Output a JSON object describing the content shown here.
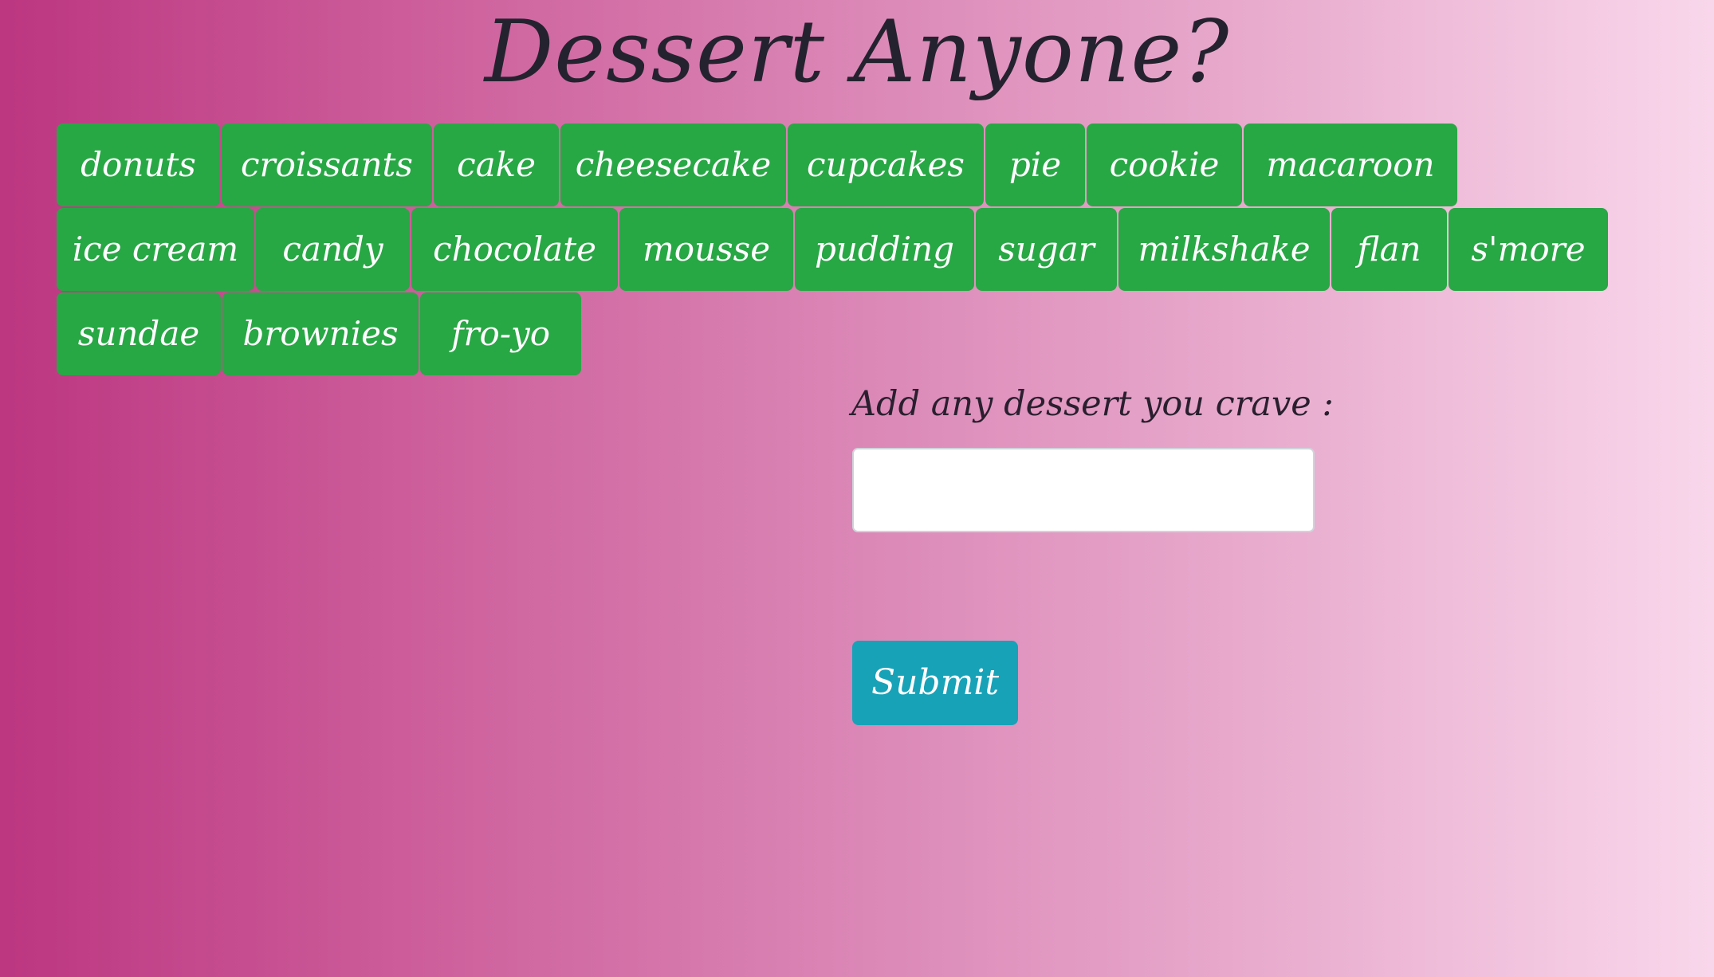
{
  "header": {
    "title": "Dessert Anyone?"
  },
  "desserts": {
    "row1": [
      "donuts",
      "croissants",
      "cake",
      "cheesecake",
      "cupcakes",
      "pie",
      "cookie",
      "macaroon"
    ],
    "row2": [
      "ice cream",
      "candy",
      "chocolate",
      "mousse",
      "pudding",
      "sugar",
      "milkshake",
      "flan",
      "s'more"
    ],
    "row3": [
      "sundae",
      "brownies",
      "fro-yo"
    ]
  },
  "form": {
    "label": "Add any dessert you crave :",
    "input_value": "",
    "input_placeholder": "",
    "submit_label": "Submit"
  },
  "colors": {
    "button_green": "#28a745",
    "submit_teal": "#17a2b8",
    "gradient_start": "#bc3680",
    "gradient_end": "#f9d7eb"
  }
}
